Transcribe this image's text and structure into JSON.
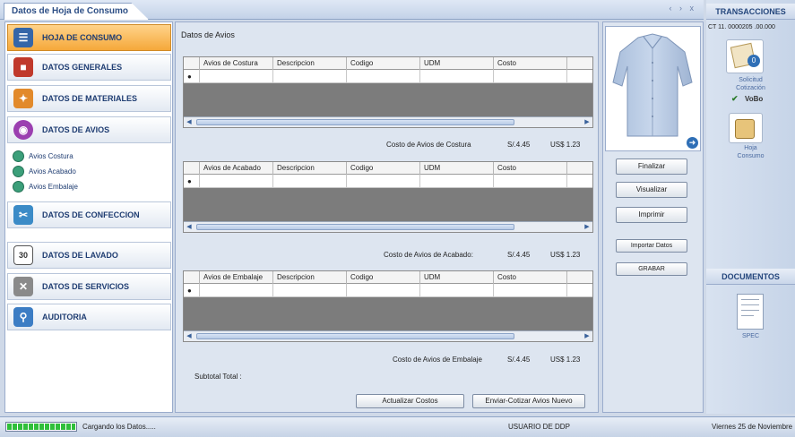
{
  "window": {
    "tab_title": "Datos de Hoja de Consumo",
    "controls": "‹ › x"
  },
  "nav": {
    "items": [
      {
        "label": "HOJA DE CONSUMO",
        "active": true
      },
      {
        "label": "DATOS GENERALES"
      },
      {
        "label": "DATOS DE MATERIALES"
      },
      {
        "label": "DATOS DE AVIOS"
      },
      {
        "label": "DATOS DE CONFECCION"
      },
      {
        "label": "DATOS DE LAVADO"
      },
      {
        "label": "DATOS DE SERVICIOS"
      },
      {
        "label": "AUDITORIA"
      }
    ],
    "subitems": [
      "Avios Costura",
      "Avios Acabado",
      "Avios Embalaje"
    ]
  },
  "section": {
    "title": "Datos de Avios"
  },
  "grids": [
    {
      "columns": [
        "Avios de Costura",
        "Descripcion",
        "Codigo",
        "UDM",
        "Costo"
      ],
      "cost_label": "Costo de Avios de Costura",
      "cost_pen": "S/.4.45",
      "cost_usd": "US$ 1.23"
    },
    {
      "columns": [
        "Avios de Acabado",
        "Descripcion",
        "Codigo",
        "UDM",
        "Costo"
      ],
      "cost_label": "Costo de Avios de Acabado:",
      "cost_pen": "S/.4.45",
      "cost_usd": "US$ 1.23"
    },
    {
      "columns": [
        "Avios de Embalaje",
        "Descripcion",
        "Codigo",
        "UDM",
        "Costo"
      ],
      "cost_label": "Costo de Avios de Embalaje",
      "cost_pen": "S/.4.45",
      "cost_usd": "US$ 1.23"
    }
  ],
  "subtotal_label": "Subtotal Total :",
  "bottom_buttons": {
    "update": "Actualizar Costos",
    "send": "Enviar-Cotizar Avios Nuevo"
  },
  "side_buttons": {
    "finalize": "Finalizar",
    "view": "Visualizar",
    "print": "Imprimir",
    "import": "Importar Datos",
    "save": "GRABAR"
  },
  "transactions": {
    "header": "TRANSACCIONES",
    "code": "CT 11. 0000205 .00.000",
    "request_label_1": "Solicitud",
    "request_label_2": "Cotización",
    "approval": "VoBo",
    "consumption_label_1": "Hoja",
    "consumption_label_2": "Consumo",
    "documents_header": "DOCUMENTOS",
    "spec_label": "SPEC"
  },
  "status": {
    "loading": "Cargando los Datos.....",
    "user": "USUARIO DE DDP",
    "date": "Viernes 25 de Noviembre"
  },
  "colors": {
    "accent": "#f5a83a",
    "brand": "#2d4f86"
  }
}
